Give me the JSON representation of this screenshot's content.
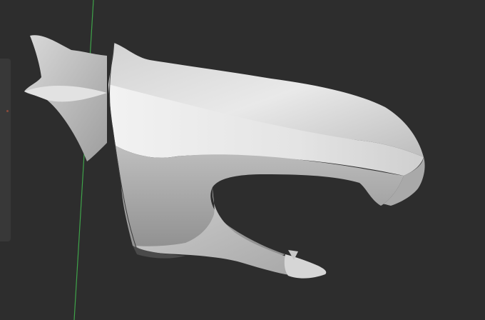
{
  "viewport": {
    "background": "#2d2d2d",
    "axis_color": "#3fa34a"
  },
  "model": {
    "shade_light": "#e6e6e6",
    "shade_mid": "#c4c4c4",
    "shade_dark": "#8f8f8f",
    "shadow": "#5a5a5a"
  },
  "icons": {
    "side_panel": "panel-toggle-icon"
  }
}
